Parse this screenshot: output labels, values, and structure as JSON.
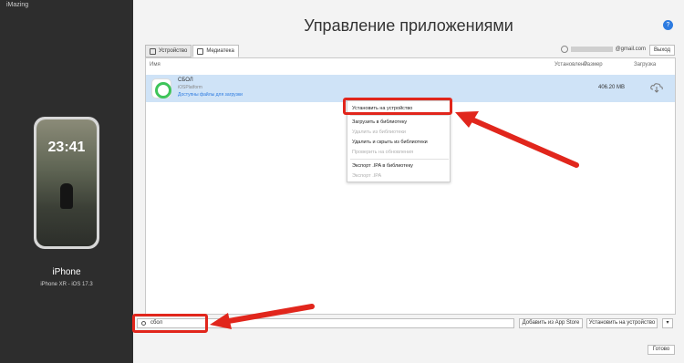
{
  "window": {
    "title": "iMazing"
  },
  "device": {
    "name": "iPhone",
    "subtitle": "iPhone XR - iOS 17.3",
    "lock_time": "23:41"
  },
  "page": {
    "title": "Управление приложениями",
    "help_label": "?"
  },
  "tabs": [
    {
      "label": "Устройство"
    },
    {
      "label": "Медиатека"
    }
  ],
  "account": {
    "email_suffix": "@gmail.com",
    "logout_label": "Выход"
  },
  "table": {
    "columns": [
      "Имя",
      "Установлено",
      "Размер",
      "Загрузка"
    ],
    "rows": [
      {
        "name": "СБОЛ",
        "developer": "iOSPlatform",
        "status": "Доступны файлы для загрузки",
        "size": "406.20 MB"
      }
    ]
  },
  "context_menu": {
    "items": [
      {
        "label": "Установить на устройство",
        "enabled": true
      },
      {
        "label": "Загрузить в библиотеку",
        "enabled": true
      },
      {
        "label": "Удалить из библиотеки",
        "enabled": false
      },
      {
        "label": "Удалить и скрыть из библиотеки",
        "enabled": true
      },
      {
        "label": "Проверить на обновления",
        "enabled": false
      },
      {
        "label": "Экспорт .IPA в библиотеку",
        "enabled": true
      },
      {
        "label": "Экспорт .IPA",
        "enabled": false
      }
    ]
  },
  "bottom": {
    "search_value": "сбол",
    "add_from_store_label": "Добавить из App Store",
    "install_label": "Установить на устройство",
    "done_label": "Готово"
  },
  "colors": {
    "highlight": "#e1261c",
    "accent": "#2d7be0",
    "row_selected": "#cfe3f7"
  }
}
